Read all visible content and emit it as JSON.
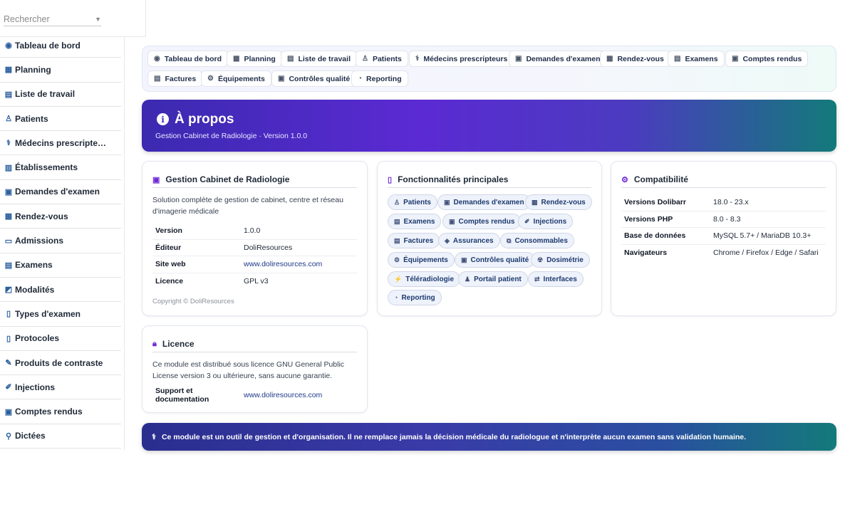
{
  "search": {
    "placeholder": "Rechercher"
  },
  "sidebar": {
    "items": [
      {
        "label": "Tableau de bord",
        "icon": "dashboard-icon",
        "glyph": "◉"
      },
      {
        "label": "Planning",
        "icon": "calendar-icon",
        "glyph": "▦"
      },
      {
        "label": "Liste de travail",
        "icon": "worklist-icon",
        "glyph": "▤"
      },
      {
        "label": "Patients",
        "icon": "user-icon",
        "glyph": "♙"
      },
      {
        "label": "Médecins prescripte…",
        "icon": "doctor-icon",
        "glyph": "⚕"
      },
      {
        "label": "Établissements",
        "icon": "building-icon",
        "glyph": "▥"
      },
      {
        "label": "Demandes d'examen",
        "icon": "request-icon",
        "glyph": "▣"
      },
      {
        "label": "Rendez-vous",
        "icon": "appointment-icon",
        "glyph": "▦"
      },
      {
        "label": "Admissions",
        "icon": "id-card-icon",
        "glyph": "▭"
      },
      {
        "label": "Examens",
        "icon": "exam-icon",
        "glyph": "▤"
      },
      {
        "label": "Modalités",
        "icon": "modality-icon",
        "glyph": "◩"
      },
      {
        "label": "Types d'examen",
        "icon": "clipboard-icon",
        "glyph": "▯"
      },
      {
        "label": "Protocoles",
        "icon": "protocol-icon",
        "glyph": "▯"
      },
      {
        "label": "Produits de contraste",
        "icon": "pen-icon",
        "glyph": "✎"
      },
      {
        "label": "Injections",
        "icon": "syringe-icon",
        "glyph": "✐"
      },
      {
        "label": "Comptes rendus",
        "icon": "report-icon",
        "glyph": "▣"
      },
      {
        "label": "Dictées",
        "icon": "microphone-icon",
        "glyph": "⚲"
      }
    ]
  },
  "topnav": {
    "items": [
      {
        "label": "Tableau de bord",
        "icon": "dashboard-icon",
        "glyph": "◉"
      },
      {
        "label": "Planning",
        "icon": "calendar-icon",
        "glyph": "▦"
      },
      {
        "label": "Liste de travail",
        "icon": "worklist-icon",
        "glyph": "▤"
      },
      {
        "label": "Patients",
        "icon": "user-icon",
        "glyph": "♙"
      },
      {
        "label": "Médecins prescripteurs",
        "icon": "doctor-icon",
        "glyph": "⚕"
      },
      {
        "label": "Demandes d'examen",
        "icon": "request-icon",
        "glyph": "▣"
      },
      {
        "label": "Rendez-vous",
        "icon": "appointment-icon",
        "glyph": "▦"
      },
      {
        "label": "Examens",
        "icon": "exam-icon",
        "glyph": "▤"
      },
      {
        "label": "Comptes rendus",
        "icon": "report-icon",
        "glyph": "▣"
      },
      {
        "label": "Factures",
        "icon": "invoice-icon",
        "glyph": "▤"
      },
      {
        "label": "Équipements",
        "icon": "gears-icon",
        "glyph": "⚙"
      },
      {
        "label": "Contrôles qualité",
        "icon": "quality-icon",
        "glyph": "▣"
      },
      {
        "label": "Reporting",
        "icon": "chart-pie-icon",
        "glyph": "◔"
      }
    ]
  },
  "banner": {
    "title": "À propos",
    "subtitle": "Gestion Cabinet de Radiologie · Version 1.0.0",
    "info_glyph": "i"
  },
  "about_card": {
    "title": "Gestion Cabinet de Radiologie",
    "description_line1": "Solution complète de gestion de cabinet, centre et réseau",
    "description_line2": "d'imagerie médicale",
    "rows": [
      {
        "key": "Version",
        "value": "1.0.0"
      },
      {
        "key": "Éditeur",
        "value": "DoliResources"
      },
      {
        "key": "Site web",
        "value": "www.doliresources.com"
      },
      {
        "key": "Licence",
        "value": "GPL v3"
      }
    ],
    "copyright": "Copyright © DoliResources"
  },
  "features_card": {
    "title": "Fonctionnalités principales",
    "pills": [
      {
        "label": "Patients",
        "glyph": "♙"
      },
      {
        "label": "Demandes d'examen",
        "glyph": "▣"
      },
      {
        "label": "Rendez-vous",
        "glyph": "▦"
      },
      {
        "label": "Examens",
        "glyph": "▤"
      },
      {
        "label": "Comptes rendus",
        "glyph": "▣"
      },
      {
        "label": "Injections",
        "glyph": "✐"
      },
      {
        "label": "Factures",
        "glyph": "▤"
      },
      {
        "label": "Assurances",
        "glyph": "◈"
      },
      {
        "label": "Consommables",
        "glyph": "⧉"
      },
      {
        "label": "Équipements",
        "glyph": "⚙"
      },
      {
        "label": "Contrôles qualité",
        "glyph": "▣"
      },
      {
        "label": "Dosimétrie",
        "glyph": "☢"
      },
      {
        "label": "Téléradiologie",
        "glyph": "⚡"
      },
      {
        "label": "Portail patient",
        "glyph": "♟"
      },
      {
        "label": "Interfaces",
        "glyph": "⇄"
      },
      {
        "label": "Reporting",
        "glyph": "◔"
      }
    ]
  },
  "compat_card": {
    "title": "Compatibilité",
    "rows": [
      {
        "key": "Versions Dolibarr",
        "value": "18.0 - 23.x"
      },
      {
        "key": "Versions PHP",
        "value": "8.0 - 8.3"
      },
      {
        "key": "Base de données",
        "value": "MySQL 5.7+ / MariaDB 10.3+"
      },
      {
        "key": "Navigateurs",
        "value": "Chrome / Firefox / Edge / Safari"
      }
    ]
  },
  "license_card": {
    "title": "Licence",
    "text_line1": "Ce module est distribué sous licence GNU General Public",
    "text_line2": "License version 3 ou ultérieure, sans aucune garantie.",
    "support_key": "Support et documentation",
    "support_value": "www.doliresources.com"
  },
  "footer": {
    "text": "Ce module est un outil de gestion et d'organisation. Il ne remplace jamais la décision médicale du radiologue et n'interprète aucun examen sans validation humaine."
  },
  "colors": {
    "accent": "#6d28d9",
    "banner_start": "#3b2ab0",
    "banner_end": "#137a7a",
    "link": "#1e3a8a"
  }
}
